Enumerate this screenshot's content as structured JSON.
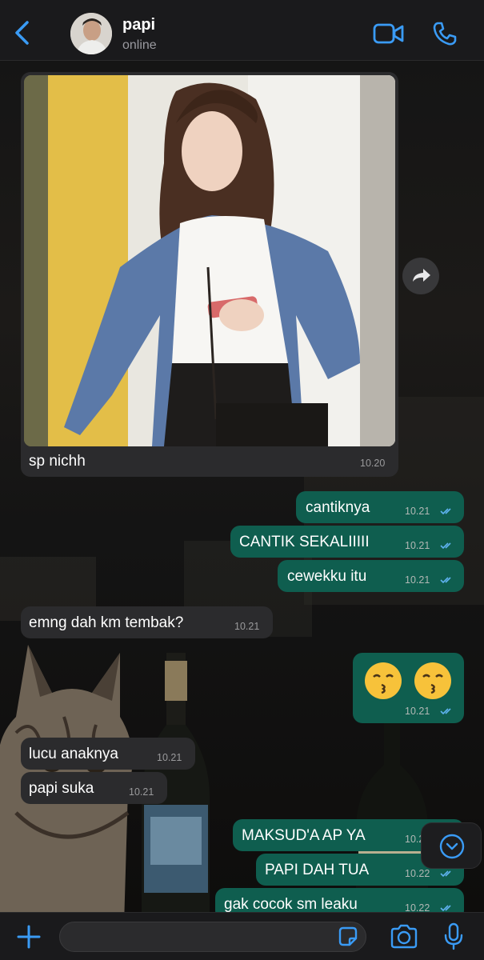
{
  "header": {
    "back_icon": "chevron-left-icon",
    "contact_name": "papi",
    "contact_status": "online",
    "video_icon": "video-camera-icon",
    "phone_icon": "phone-icon"
  },
  "colors": {
    "accent": "#3a9bf5",
    "outgoing_bubble": "#0f5e4f",
    "incoming_bubble": "#2b2b2d",
    "read_tick": "#5fb2f0"
  },
  "messages": [
    {
      "direction": "in",
      "type": "image",
      "caption": "sp nichh",
      "time": "10.20"
    },
    {
      "direction": "out",
      "text": "cantiknya",
      "time": "10.21",
      "status": "read"
    },
    {
      "direction": "out",
      "text": "CANTIK SEKALIIIII",
      "time": "10.21",
      "status": "read"
    },
    {
      "direction": "out",
      "text": "cewekku itu",
      "time": "10.21",
      "status": "read"
    },
    {
      "direction": "in",
      "text": "emng dah km tembak?",
      "time": "10.21"
    },
    {
      "direction": "out",
      "text": "😙 😙",
      "time": "10.21",
      "status": "read"
    },
    {
      "direction": "in",
      "text": "lucu anaknya",
      "time": "10.21"
    },
    {
      "direction": "in",
      "text": "papi suka",
      "time": "10.21"
    },
    {
      "direction": "out",
      "text": "MAKSUD'A AP YA",
      "time": "10.22",
      "status": "read"
    },
    {
      "direction": "out",
      "text": "PAPI DAH TUA",
      "time": "10.22",
      "status": "read"
    },
    {
      "direction": "out",
      "text": "gak cocok sm leaku",
      "time": "10.22",
      "status": "read"
    }
  ],
  "controls": {
    "forward_icon": "share-forward-icon",
    "scroll_down_icon": "chevron-down-circle-icon"
  },
  "composer": {
    "plus_icon": "plus-icon",
    "input_value": "",
    "sticker_icon": "sticker-icon",
    "camera_icon": "camera-icon",
    "mic_icon": "microphone-icon"
  }
}
